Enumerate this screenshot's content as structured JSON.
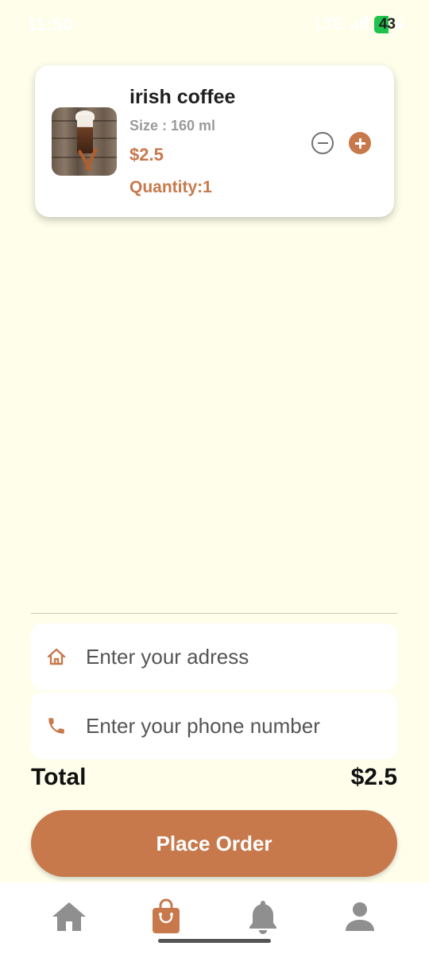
{
  "status_bar": {
    "time": "11:50",
    "network": "LTE",
    "battery": "43"
  },
  "cart_item": {
    "name": "irish coffee",
    "size": "Size : 160 ml",
    "price": "$2.5",
    "quantity": "Quantity:1",
    "image": "irish-coffee-photo"
  },
  "form": {
    "address_placeholder": "Enter your adress",
    "phone_placeholder": "Enter your phone number"
  },
  "summary": {
    "total_label": "Total",
    "total_value": "$2.5"
  },
  "actions": {
    "place_order_label": "Place Order"
  },
  "bottom_nav": {
    "items": [
      {
        "icon": "home-icon",
        "active": false
      },
      {
        "icon": "shopping-bag-icon",
        "active": true
      },
      {
        "icon": "bell-icon",
        "active": false
      },
      {
        "icon": "person-icon",
        "active": false
      }
    ]
  },
  "colors": {
    "background": "#fefeea",
    "accent": "#c7794c",
    "inactive_icon": "#8f8f8f"
  }
}
